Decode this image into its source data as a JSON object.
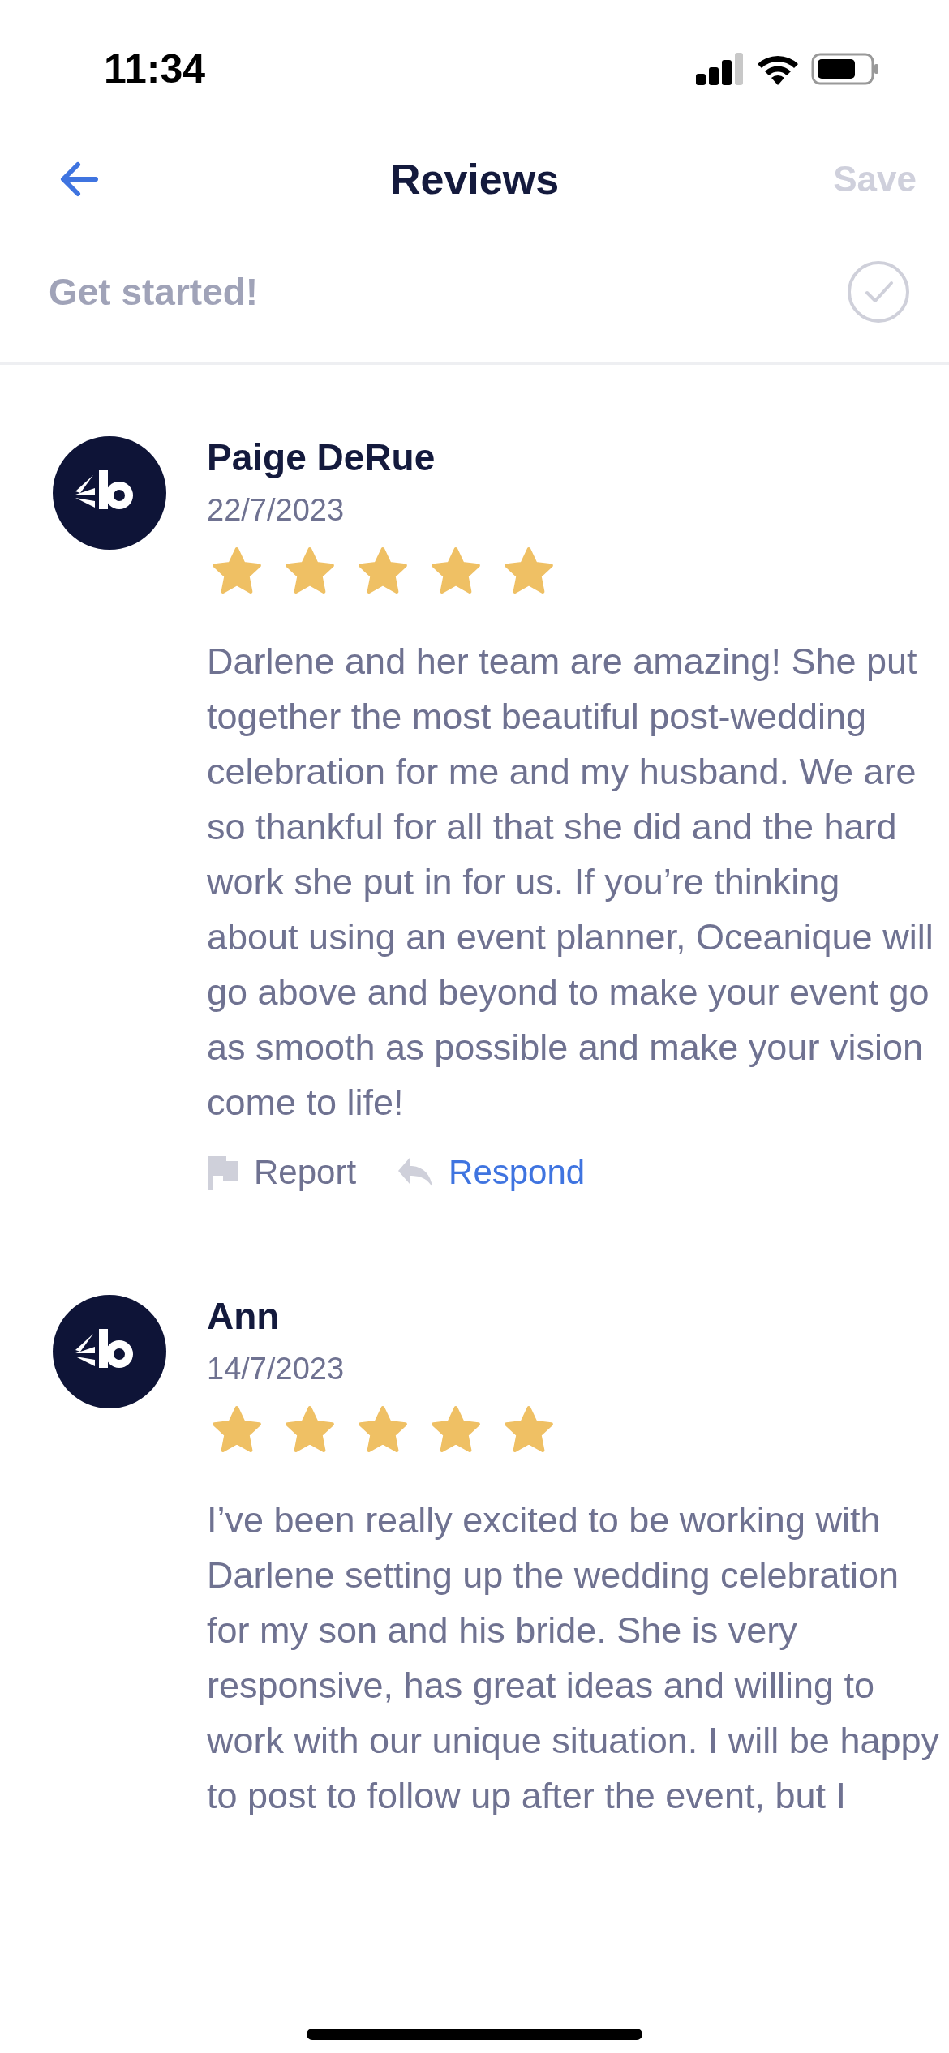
{
  "status_bar": {
    "time": "11:34"
  },
  "nav": {
    "title": "Reviews",
    "save": {
      "label": "Save",
      "disabled": true
    }
  },
  "banner": {
    "label": "Get started!"
  },
  "reviews": [
    {
      "name": "Paige DeRue",
      "date": "22/7/2023",
      "stars": 5,
      "text": "Darlene and her team are amazing! She put together the most beautiful post-wedding celebration for me and my husband. We are so thankful for all that she did and the hard work she put in for us. If you’re thinking about using an event planner, Oceanique will go above and beyond to make your event go as smooth as possible and make your vision come to life!",
      "actions": [
        {
          "kind": "report",
          "label": "Report"
        },
        {
          "kind": "respond",
          "label": "Respond"
        }
      ]
    },
    {
      "name": "Ann",
      "date": "14/7/2023",
      "stars": 5,
      "text": "I’ve been really excited to be working with Darlene setting up the wedding celebration for my son and his bride. She is very responsive, has great ideas and willing to work with our unique situation.  I will be happy to post to follow up after the event, but I"
    }
  ]
}
